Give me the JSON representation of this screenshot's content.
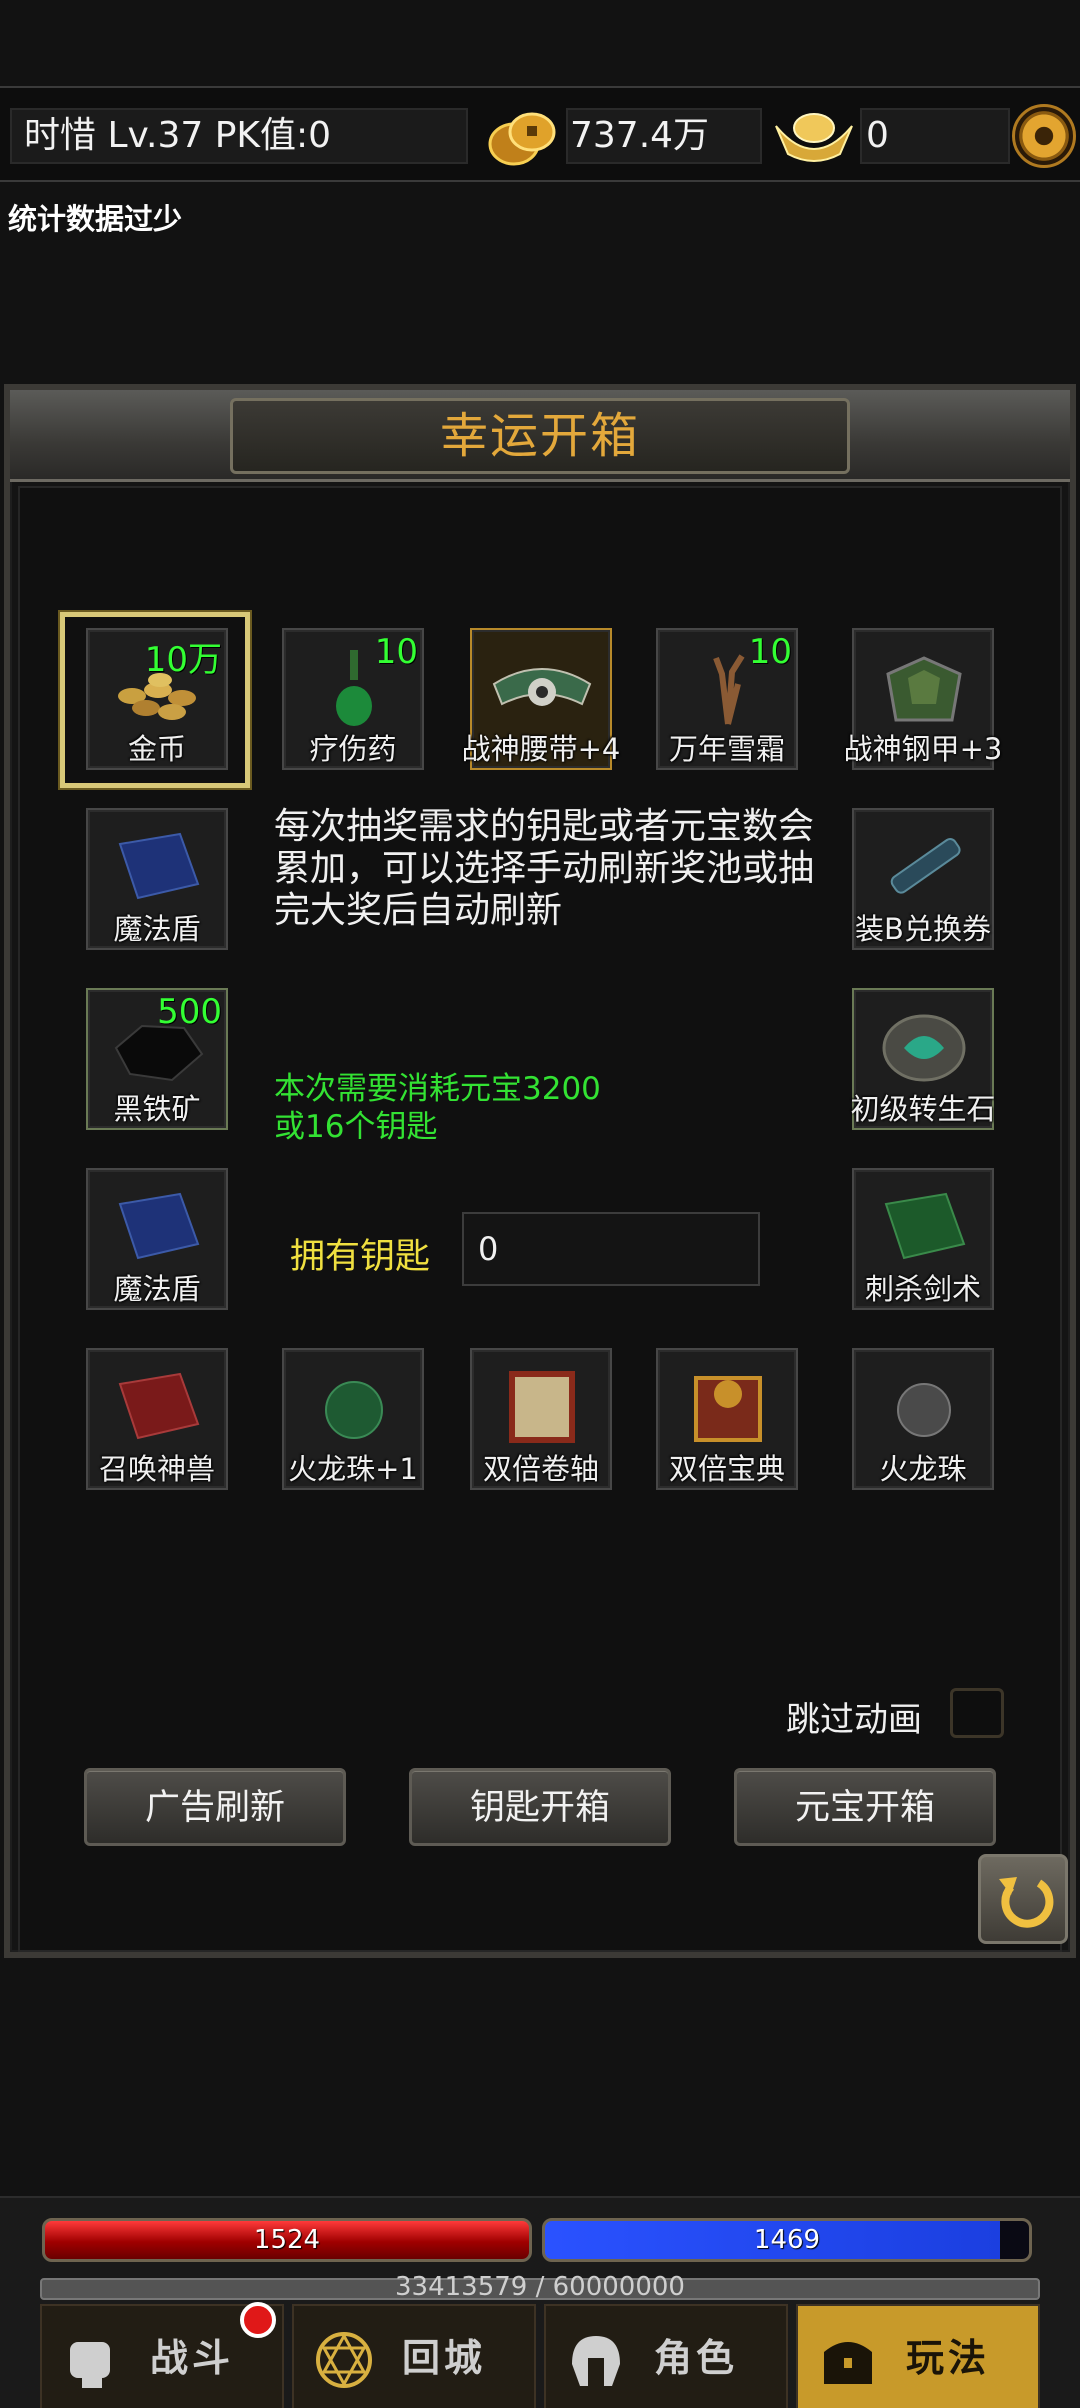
{
  "topbar": {
    "player": "时惜  Lv.37 PK值:0",
    "gold": "737.4万",
    "ingot": "0"
  },
  "stats_message": "统计数据过少",
  "panel": {
    "title": "幸运开箱",
    "info": "每次抽奖需求的钥匙或者元宝数会累加，可以选择手动刷新奖池或抽完大奖后自动刷新",
    "cost_line1": "本次需要消耗元宝3200",
    "cost_line2": "或16个钥匙",
    "keys_label": "拥有钥匙",
    "keys_value": "0",
    "skip_label": "跳过动画",
    "buttons": {
      "ad_refresh": "广告刷新",
      "key_open": "钥匙开箱",
      "ingot_open": "元宝开箱"
    }
  },
  "items": [
    {
      "name": "金币",
      "qty": "10万",
      "icon": "gold-coins-icon"
    },
    {
      "name": "疗伤药",
      "qty": "10",
      "icon": "potion-icon"
    },
    {
      "name": "战神腰带+4",
      "qty": "",
      "icon": "belt-icon"
    },
    {
      "name": "万年雪霜",
      "qty": "10",
      "icon": "herb-icon"
    },
    {
      "name": "战神钢甲+3",
      "qty": "",
      "icon": "armor-icon"
    },
    {
      "name": "魔法盾",
      "qty": "",
      "icon": "blue-book-icon"
    },
    {
      "name": "装B兑换券",
      "qty": "",
      "icon": "scroll-icon"
    },
    {
      "name": "黑铁矿",
      "qty": "500",
      "icon": "ore-icon"
    },
    {
      "name": "初级转生石",
      "qty": "",
      "icon": "rune-stone-icon"
    },
    {
      "name": "魔法盾",
      "qty": "",
      "icon": "blue-book-icon"
    },
    {
      "name": "刺杀剑术",
      "qty": "",
      "icon": "green-book-icon"
    },
    {
      "name": "召唤神兽",
      "qty": "",
      "icon": "red-book-icon"
    },
    {
      "name": "火龙珠+1",
      "qty": "",
      "icon": "green-orb-icon"
    },
    {
      "name": "双倍卷轴",
      "qty": "",
      "icon": "red-scroll-icon"
    },
    {
      "name": "双倍宝典",
      "qty": "",
      "icon": "red-tome-icon"
    },
    {
      "name": "火龙珠",
      "qty": "",
      "icon": "grey-orb-icon"
    }
  ],
  "hud": {
    "hp": "1524",
    "mp": "1469",
    "exp": "33413579 / 60000000",
    "nav": [
      {
        "label": "战斗"
      },
      {
        "label": "回城"
      },
      {
        "label": "角色"
      },
      {
        "label": "玩法"
      }
    ]
  },
  "colors": {
    "title_gold": "#e3a83b",
    "qty_green": "#33ff33",
    "cost_green": "#33e233",
    "keys_yellow": "#f0e040"
  }
}
